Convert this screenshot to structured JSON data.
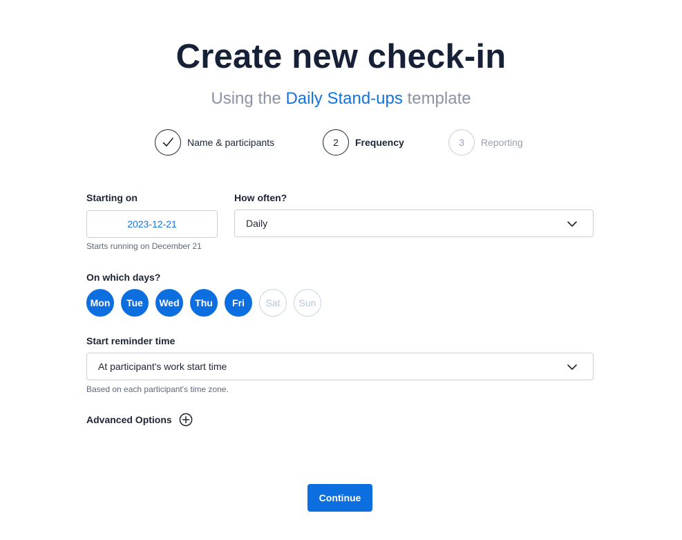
{
  "header": {
    "title": "Create new check-in",
    "subtitle_prefix": "Using the",
    "template_name": "Daily Stand-ups",
    "subtitle_suffix": "template"
  },
  "steps": [
    {
      "number": "",
      "label": "Name & participants",
      "state": "done",
      "icon": "check-icon"
    },
    {
      "number": "2",
      "label": "Frequency",
      "state": "active"
    },
    {
      "number": "3",
      "label": "Reporting",
      "state": "pending"
    }
  ],
  "starting_on": {
    "label": "Starting on",
    "value": "2023-12-21",
    "hint": "Starts running on December 21"
  },
  "how_often": {
    "label": "How often?",
    "value": "Daily",
    "icon": "chevron-down-icon"
  },
  "days": {
    "label": "On which days?",
    "items": [
      {
        "label": "Mon",
        "selected": true
      },
      {
        "label": "Tue",
        "selected": true
      },
      {
        "label": "Wed",
        "selected": true
      },
      {
        "label": "Thu",
        "selected": true
      },
      {
        "label": "Fri",
        "selected": true
      },
      {
        "label": "Sat",
        "selected": false
      },
      {
        "label": "Sun",
        "selected": false
      }
    ]
  },
  "reminder": {
    "label": "Start reminder time",
    "value": "At participant's work start time",
    "hint": "Based on each participant's time zone.",
    "icon": "chevron-down-icon"
  },
  "advanced": {
    "label": "Advanced Options",
    "icon": "plus-circle-icon"
  },
  "footer": {
    "continue_label": "Continue"
  },
  "colors": {
    "primary": "#0d6ee0",
    "link": "#1273de",
    "heading": "#162036",
    "muted": "#8a93a6"
  }
}
